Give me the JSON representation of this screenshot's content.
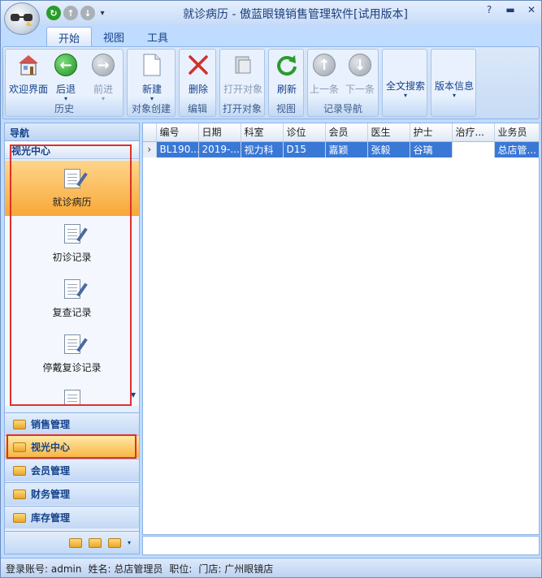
{
  "window": {
    "title": "就诊病历 - 傲蓝眼镜销售管理软件[试用版本]",
    "controls": [
      "?",
      "▬",
      "✕"
    ]
  },
  "ribbon_tabs": [
    {
      "label": "开始",
      "active": true
    },
    {
      "label": "视图",
      "active": false
    },
    {
      "label": "工具",
      "active": false
    }
  ],
  "ribbon": {
    "groups": {
      "history": "历史",
      "create": "对象创建",
      "edit": "编辑",
      "open": "打开对象",
      "view": "视图",
      "nav": "记录导航"
    },
    "buttons": {
      "welcome": "欢迎界面",
      "back": "后退",
      "forward": "前进",
      "new": "新建",
      "delete": "删除",
      "open_obj": "打开对象",
      "refresh": "刷新",
      "prev": "上一条",
      "next": "下一条",
      "search": "全文搜索",
      "version": "版本信息"
    }
  },
  "nav": {
    "header": "导航",
    "section": "视光中心",
    "items": [
      {
        "label": "就诊病历",
        "active": true
      },
      {
        "label": "初诊记录",
        "active": false
      },
      {
        "label": "复查记录",
        "active": false
      },
      {
        "label": "停戴复诊记录",
        "active": false
      }
    ],
    "categories": [
      {
        "label": "销售管理",
        "active": false
      },
      {
        "label": "视光中心",
        "active": true
      },
      {
        "label": "会员管理",
        "active": false
      },
      {
        "label": "财务管理",
        "active": false
      },
      {
        "label": "库存管理",
        "active": false
      }
    ]
  },
  "grid": {
    "columns": [
      "编号",
      "日期",
      "科室",
      "诊位",
      "会员",
      "医生",
      "护士",
      "治疗...",
      "业务员"
    ],
    "rows": [
      [
        "BL190...",
        "2019-...",
        "视力科",
        "D15",
        "嘉颖",
        "张毅",
        "谷璃",
        "",
        "总店管..."
      ]
    ]
  },
  "status": {
    "account": "登录账号: admin",
    "name": "姓名: 总店管理员",
    "position": "职位:",
    "store": "门店: 广州眼镜店"
  },
  "colors": {
    "accent": "#f7a837",
    "selection": "#3a78d6",
    "highlight_box": "#e0302a"
  }
}
